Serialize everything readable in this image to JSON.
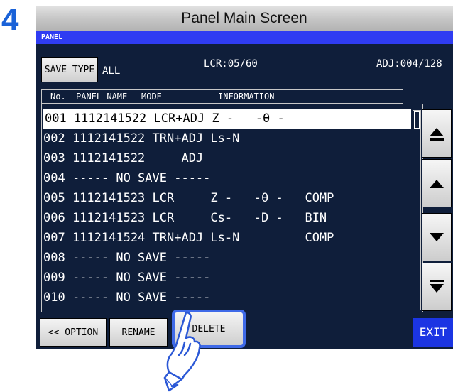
{
  "step_number": "4",
  "caption": "Panel Main Screen",
  "screen": {
    "title": "PANEL",
    "save_type_label": "SAVE TYPE",
    "save_type_value": "ALL",
    "lcr_count": "LCR:05/60",
    "adj_count": "ADJ:004/128",
    "columns": {
      "no": "No.",
      "panel_name": "PANEL NAME",
      "mode": "MODE",
      "information": "INFORMATION"
    },
    "rows": [
      {
        "text": "001 1112141522 LCR+ADJ Z -   -θ -",
        "selected": true
      },
      {
        "text": "002 1112141522 TRN+ADJ Ls-N",
        "selected": false
      },
      {
        "text": "003 1112141522     ADJ",
        "selected": false
      },
      {
        "text": "004 ----- NO SAVE -----",
        "selected": false
      },
      {
        "text": "005 1112141523 LCR     Z -   -θ -   COMP",
        "selected": false
      },
      {
        "text": "006 1112141523 LCR     Cs-   -D -   BIN",
        "selected": false
      },
      {
        "text": "007 1112141524 TRN+ADJ Ls-N         COMP",
        "selected": false
      },
      {
        "text": "008 ----- NO SAVE -----",
        "selected": false
      },
      {
        "text": "009 ----- NO SAVE -----",
        "selected": false
      },
      {
        "text": "010 ----- NO SAVE -----",
        "selected": false
      }
    ],
    "buttons": {
      "option": "<< OPTION",
      "rename": "RENAME",
      "delete": "DELETE",
      "exit": "EXIT"
    },
    "icons": [
      "scroll-top-icon",
      "scroll-up-icon",
      "scroll-down-icon",
      "scroll-bottom-icon",
      "pointing-hand-icon"
    ],
    "colors": {
      "screen_bg": "#0f1e3a",
      "title_bar": "#2f3cf2",
      "exit_button": "#1b35e3",
      "highlight": "#3f6ae8",
      "step_number": "#1a62d8"
    }
  }
}
